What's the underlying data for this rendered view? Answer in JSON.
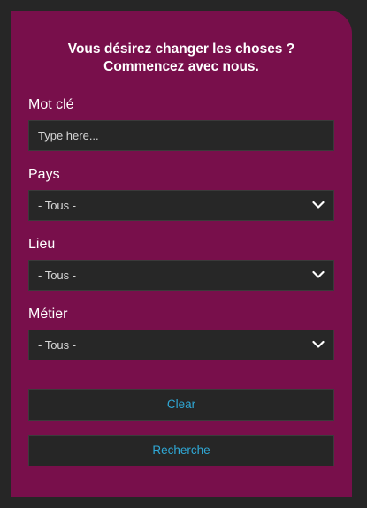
{
  "form": {
    "heading_line1": "Vous désirez changer les choses ?",
    "heading_line2": "Commencez avec nous.",
    "keyword": {
      "label": "Mot clé",
      "placeholder": "Type here..."
    },
    "country": {
      "label": "Pays",
      "selected": "- Tous -"
    },
    "place": {
      "label": "Lieu",
      "selected": "- Tous -"
    },
    "job": {
      "label": "Métier",
      "selected": "- Tous -"
    },
    "clear_label": "Clear",
    "search_label": "Recherche"
  },
  "colors": {
    "background": "#262626",
    "card": "#780f4b",
    "field_bg": "#272727",
    "button_text": "#2fa8d6"
  },
  "icons": {
    "select_arrow": "chevron-down-icon"
  }
}
